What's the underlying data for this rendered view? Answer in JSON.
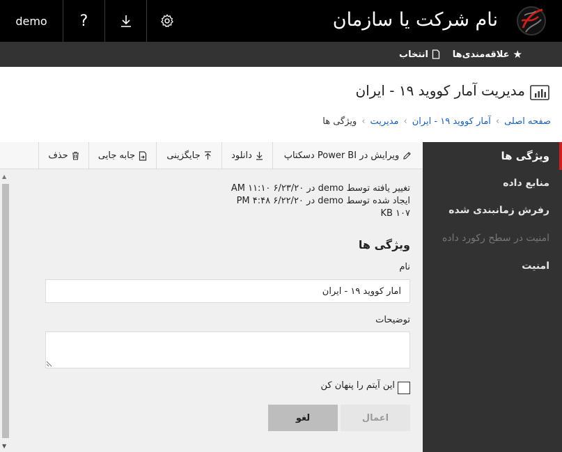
{
  "colors": {
    "topbar_bg": "#000000",
    "subbar_bg": "#333333",
    "nav_bg": "#323232",
    "accent": "#d0201c",
    "link": "#1a5fb4"
  },
  "topbar": {
    "user_label": "demo",
    "help_label": "?",
    "download_icon": "download-icon",
    "settings_icon": "gear-icon",
    "brand_title": "نام شرکت یا سازمان",
    "brand_logo_icon": "company-logo-icon"
  },
  "subbar": {
    "favorites_label": "علاقه‌مندی‌ها",
    "favorites_icon": "star-icon",
    "select_label": "انتخاب",
    "select_icon": "page-icon"
  },
  "header": {
    "title": "مدیریت آمار کووید ۱۹ - ایران",
    "title_icon": "report-chart-icon",
    "breadcrumb": [
      {
        "label": "صفحه اصلی",
        "link": true
      },
      {
        "label": "آمار کووید ۱۹ - ایران",
        "link": true
      },
      {
        "label": "مدیریت",
        "link": true
      },
      {
        "label": "ویژگی ها",
        "link": false
      }
    ]
  },
  "toolbar": {
    "edit_label": "ویرایش در Power BI دسکتاپ",
    "download_label": "دانلود",
    "replace_label": "جایگزینی",
    "move_label": "جابه جایی",
    "delete_label": "حذف"
  },
  "meta": {
    "modified": "تغییر یافته توسط demo در ۶/۲۳/۲۰ ۱۱:۱۰ AM",
    "created": "ایجاد شده توسط demo در ۶/۲۲/۲۰ ۴:۴۸ PM",
    "size": "۱۰۷ KB"
  },
  "form": {
    "section_title": "ویژگی ها",
    "name_label": "نام",
    "name_value": "آمار کووید ۱۹ - ایران",
    "description_label": "توضیحات",
    "description_value": "",
    "hide_label": "این آیتم را پنهان کن",
    "hide_checked": false,
    "apply_label": "اعمال",
    "cancel_label": "لغو"
  },
  "nav": {
    "items": [
      {
        "label": "ویژگی ها",
        "state": "active"
      },
      {
        "label": "منابع داده",
        "state": "normal"
      },
      {
        "label": "رفرش زمانبندی شده",
        "state": "normal"
      },
      {
        "label": "امنیت در سطح رکورد داده",
        "state": "disabled"
      },
      {
        "label": "امنیت",
        "state": "normal"
      }
    ]
  }
}
